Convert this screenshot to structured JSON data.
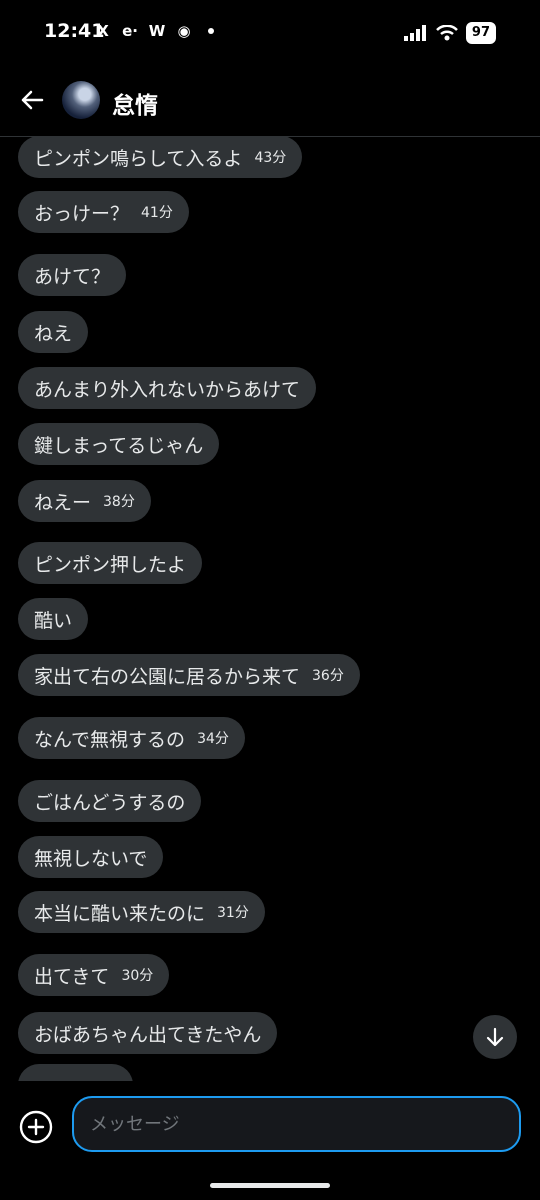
{
  "status_bar": {
    "time": "12:41",
    "app_icons": [
      "X",
      "e·",
      "W",
      "◉"
    ],
    "battery": "97"
  },
  "header": {
    "back_icon": "arrow-left-icon",
    "name": "怠惰"
  },
  "messages": [
    {
      "text": "ピンポン鳴らして入るよ",
      "time": "43分"
    },
    {
      "text": "おっけー？",
      "time": "41分"
    },
    {
      "text": "あけて？",
      "time": ""
    },
    {
      "text": "ねえ",
      "time": ""
    },
    {
      "text": "あんまり外入れないからあけて",
      "time": ""
    },
    {
      "text": "鍵しまってるじゃん",
      "time": ""
    },
    {
      "text": "ねえー",
      "time": "38分"
    },
    {
      "text": "ピンポン押したよ",
      "time": ""
    },
    {
      "text": "酷い",
      "time": ""
    },
    {
      "text": "家出て右の公園に居るから来て",
      "time": "36分"
    },
    {
      "text": "なんで無視するの",
      "time": "34分"
    },
    {
      "text": "ごはんどうするの",
      "time": ""
    },
    {
      "text": "無視しないで",
      "time": ""
    },
    {
      "text": "本当に酷い来たのに",
      "time": "31分"
    },
    {
      "text": "出てきて",
      "time": "30分"
    },
    {
      "text": "おばあちゃん出てきたやん",
      "time": ""
    }
  ],
  "composer": {
    "placeholder": "メッセージ"
  },
  "colors": {
    "background": "#000000",
    "bubble": "#2f3336",
    "accent": "#1d9bf0"
  }
}
